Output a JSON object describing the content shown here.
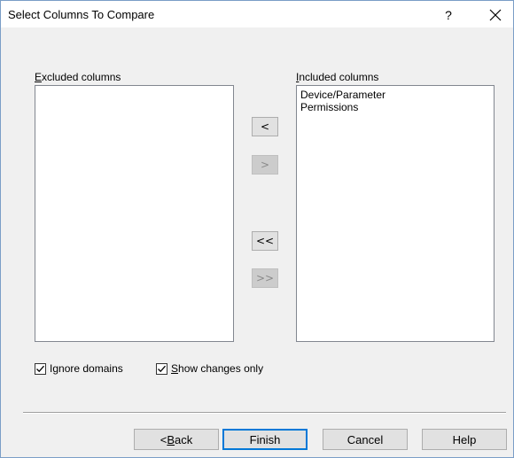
{
  "window": {
    "title": "Select Columns To Compare",
    "help_glyph": "?"
  },
  "excluded": {
    "label_mnemonic": "E",
    "label_rest": "xcluded columns",
    "items": []
  },
  "included": {
    "label_mnemonic": "I",
    "label_rest": "ncluded columns",
    "items": [
      "Device/Parameter",
      "Permissions"
    ]
  },
  "move_buttons": {
    "remove_one": "<",
    "add_one": ">",
    "remove_all": "<<",
    "add_all": ">>"
  },
  "options": {
    "ignore_domains": {
      "pre": "I",
      "mnemonic": "g",
      "post": "nore domains",
      "checked": true
    },
    "show_changes": {
      "pre": "",
      "mnemonic": "S",
      "post": "how changes only",
      "checked": true
    }
  },
  "footer": {
    "back": {
      "pre": "< ",
      "mnemonic": "B",
      "post": "ack"
    },
    "finish": "Finish",
    "cancel": "Cancel",
    "help": "Help"
  },
  "colors": {
    "dialog_bg": "#f0f0f0",
    "accent": "#0078d7",
    "disabled_button": "#cccccc"
  }
}
